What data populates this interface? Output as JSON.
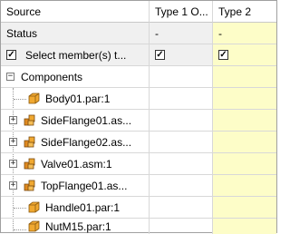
{
  "headers": {
    "source": "Source",
    "type1": "Type 1 O...",
    "type2": "Type 2"
  },
  "status_row": {
    "label": "Status",
    "type1": "-",
    "type2": "-"
  },
  "select_row": {
    "label": "Select member(s) t...",
    "checked": "✓",
    "type1_checked": "✓",
    "type2_checked": "✓"
  },
  "components": {
    "label": "Components",
    "expander": "−",
    "items": [
      {
        "name": "Body01.par:1",
        "kind": "part-icon"
      },
      {
        "name": "SideFlange01.as...",
        "kind": "assembly-icon",
        "expander": "+"
      },
      {
        "name": "SideFlange02.as...",
        "kind": "assembly-icon",
        "expander": "+"
      },
      {
        "name": "Valve01.asm:1",
        "kind": "assembly-icon",
        "expander": "+"
      },
      {
        "name": "TopFlange01.as...",
        "kind": "assembly-icon",
        "expander": "+"
      },
      {
        "name": "Handle01.par:1",
        "kind": "part-icon"
      },
      {
        "name": "NutM15.par:1",
        "kind": "part-icon"
      }
    ]
  },
  "colors": {
    "type2_column": "#fdfdc8",
    "row_bg": "#f0f0f0",
    "part_icon": "#f0a830",
    "assembly_icon": "#e08a20"
  }
}
